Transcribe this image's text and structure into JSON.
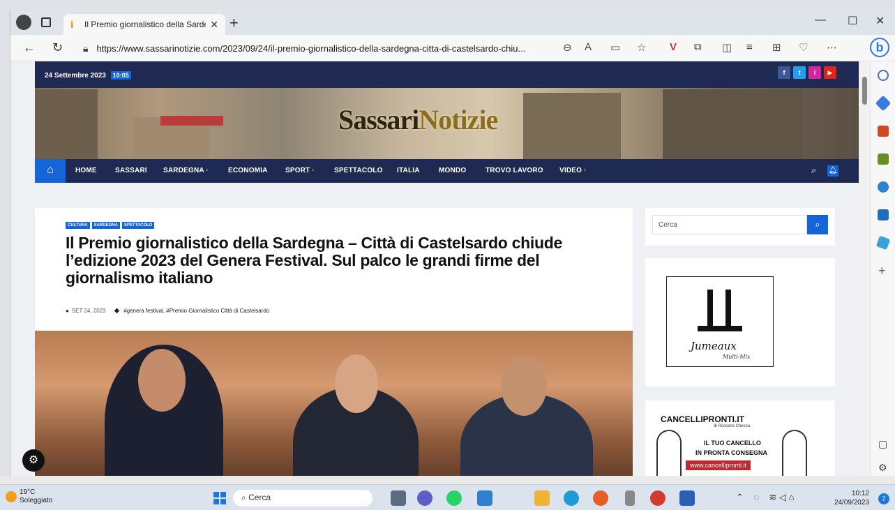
{
  "browser": {
    "tab_title": "Il Premio giornalistico della Sarde",
    "url": "https://www.sassarinotizie.com/2023/09/24/il-premio-giornalistico-della-sardegna-citta-di-castelsardo-chiu...",
    "bing_label": "b"
  },
  "site": {
    "date": "24 Settembre 2023",
    "time": "10:05",
    "brand_first": "Sassari",
    "brand_second": "Notizie",
    "nav": [
      "HOME",
      "SASSARI",
      "SARDEGNA ·",
      "ECONOMIA",
      "SPORT ·",
      "SPETTACOLO",
      "ITALIA",
      "MONDO",
      "TROVO LAVORO",
      "VIDEO ·"
    ],
    "social": [
      "f",
      "t",
      "i",
      "▶"
    ]
  },
  "article": {
    "categories": [
      "CULTURA",
      "SARDEGNA",
      "SPETTACOLO"
    ],
    "headline": "Il Premio giornalistico della Sardegna – Città di Castelsardo chiude l’edizione 2023 del Genera Festival. Sul palco le grandi firme del giornalismo italiano",
    "date": "SET 24, 2023",
    "tags": "#genera festival, #Premio Giornalistico Città di Castelsardo"
  },
  "sidebar": {
    "search_placeholder": "Cerca",
    "ad1_text": "Jumeaux",
    "ad1_sub": "Multi-Mix",
    "ad2_brand": "CANCELLIPRONTI.IT",
    "ad2_sub": "di Rossano Chessa",
    "ad2_line1": "IL TUO CANCELLO",
    "ad2_line2": "IN PRONTA CONSEGNA",
    "ad2_url": "www.cancellipronti.it"
  },
  "taskbar": {
    "temp": "19°C",
    "weather": "Soleggiato",
    "search": "Cerca",
    "time": "10:12",
    "date": "24/09/2023",
    "notif_count": "7"
  },
  "colors": {
    "navy": "#1f2a52",
    "accent": "#1565d8"
  }
}
